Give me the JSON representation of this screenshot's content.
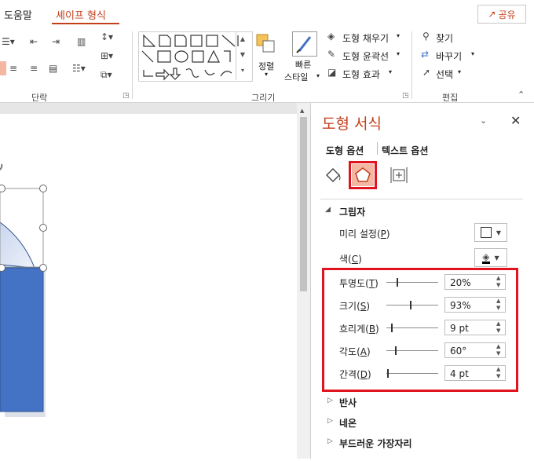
{
  "menu": {
    "help": "도움말",
    "shape_format": "셰이프 형식",
    "share_label": "공유"
  },
  "ribbon": {
    "groups": {
      "paragraph": "단락",
      "drawing": "그리기",
      "editing": "편집"
    },
    "arrange_label": "정렬",
    "quick_styles_label1": "빠른",
    "quick_styles_label2": "스타일",
    "shape_fill": "도형 채우기",
    "shape_outline": "도형 윤곽선",
    "shape_effects": "도형 효과",
    "find": "찾기",
    "replace": "바꾸기",
    "select": "선택"
  },
  "pane": {
    "title": "도형 서식",
    "tab_shape": "도형 옵션",
    "tab_text": "텍스트 옵션",
    "shadow_section": "그림자",
    "preset_label": "미리 설정",
    "preset_key": "P",
    "color_label": "색",
    "color_key": "C",
    "rows": [
      {
        "label": "투명도",
        "key": "T",
        "value": "20%",
        "level": 0.2
      },
      {
        "label": "크기",
        "key": "S",
        "value": "93%",
        "level": 0.46
      },
      {
        "label": "흐리게",
        "key": "B",
        "value": "9 pt",
        "level": 0.09
      },
      {
        "label": "각도",
        "key": "A",
        "value": "60°",
        "level": 0.17
      },
      {
        "label": "간격",
        "key": "D",
        "value": "4 pt",
        "level": 0.02
      }
    ],
    "sections": [
      "반사",
      "네온",
      "부드러운 가장자리"
    ]
  },
  "colors": {
    "accent": "#c43e1c",
    "highlight": "#e0141e",
    "shape_fill": "#4472c4",
    "selected_icon_bg": "#f4b8a2"
  }
}
